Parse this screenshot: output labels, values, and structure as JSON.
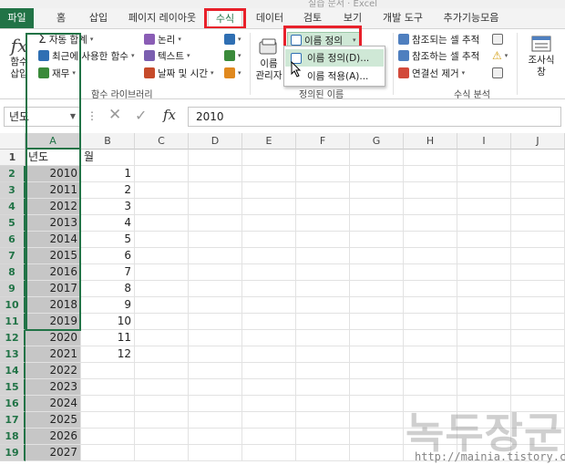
{
  "title_fragment": "실습 문서 · Excel",
  "tabs": [
    "파일",
    "홈",
    "삽입",
    "페이지 레이아웃",
    "수식",
    "데이터",
    "검토",
    "보기",
    "개발 도구",
    "추가기능모음"
  ],
  "ribbon": {
    "insert_function": {
      "symbol": "fx",
      "line1": "함수",
      "line2": "삽입"
    },
    "library": {
      "autosum": "자동 합계",
      "recent": "최근에 사용한 함수",
      "financial": "재무",
      "logical": "논리",
      "text": "텍스트",
      "datetime": "날짜 및 시간",
      "group_label": "함수 라이브러리"
    },
    "defined_names": {
      "name_manager_line1": "이름",
      "name_manager_line2": "관리자",
      "define_name": "이름 정의",
      "group_label": "정의된 이름"
    },
    "auditing": {
      "trace_precedents": "참조되는 셀 추적",
      "trace_dependents": "참조하는 셀 추적",
      "remove_arrows": "연결선 제거",
      "group_label": "수식 분석"
    },
    "watch_window": {
      "line1": "조사식",
      "line2": "창"
    }
  },
  "define_name_menu": {
    "items": [
      "이름 정의(D)...",
      "이름 적용(A)..."
    ]
  },
  "formula_bar": {
    "name_box": "년도",
    "value": "2010"
  },
  "sheet": {
    "columns": [
      "A",
      "B",
      "C",
      "D",
      "E",
      "F",
      "G",
      "H",
      "I",
      "J"
    ],
    "rows": [
      "1",
      "2",
      "3",
      "4",
      "5",
      "6",
      "7",
      "8",
      "9",
      "10",
      "11",
      "12",
      "13",
      "14",
      "15",
      "16",
      "17",
      "18",
      "19"
    ],
    "header_a": "년도",
    "header_b": "월",
    "col_a": [
      "2010",
      "2011",
      "2012",
      "2013",
      "2014",
      "2015",
      "2016",
      "2017",
      "2018",
      "2019",
      "2020",
      "2021",
      "2022",
      "2023",
      "2024",
      "2025",
      "2026",
      "2027"
    ],
    "col_b": [
      "1",
      "2",
      "3",
      "4",
      "5",
      "6",
      "7",
      "8",
      "9",
      "10",
      "11",
      "12"
    ]
  },
  "watermark": {
    "text": "녹두장군",
    "url": "http://mainia.tistory.com"
  },
  "colors": {
    "excel_green": "#217346",
    "highlight_red": "#e8202a",
    "selection_gray": "#c6c6c6"
  }
}
